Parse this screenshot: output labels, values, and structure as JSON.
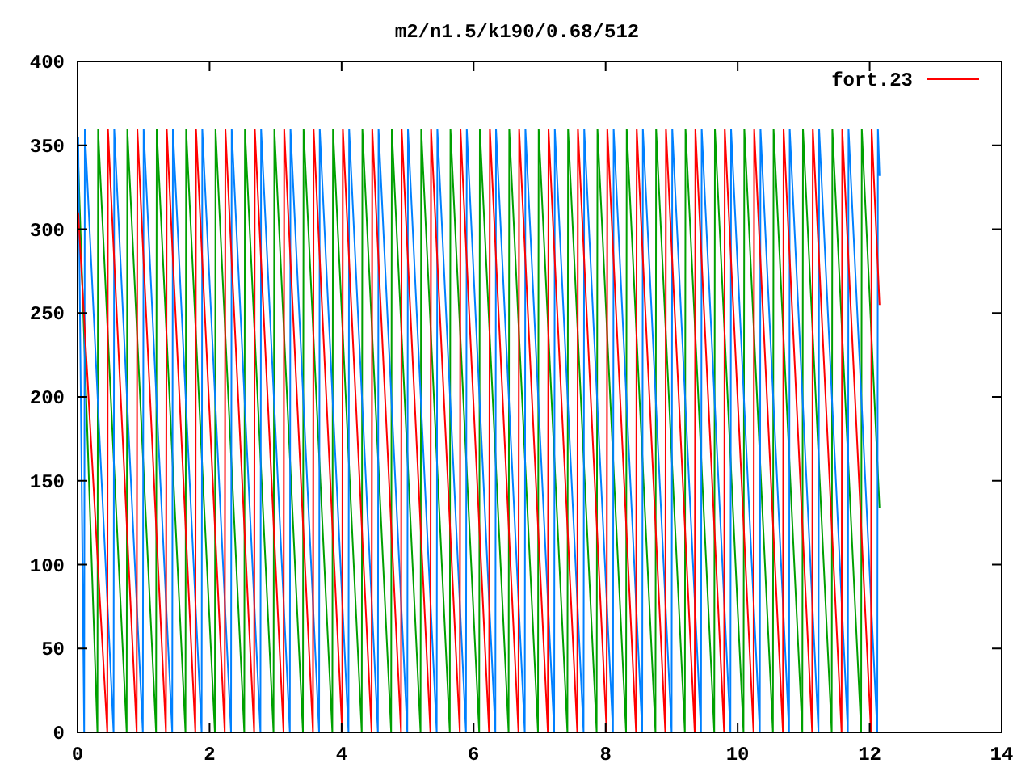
{
  "chart": {
    "title": "m2/n1.5/k190/0.68/512",
    "legend": [
      {
        "label": "fort.23",
        "color": "#ff0000"
      }
    ],
    "xticks": [
      "0",
      "2",
      "4",
      "6",
      "8",
      "10",
      "12",
      "14"
    ],
    "yticks": [
      "400",
      "350",
      "300",
      "250",
      "200",
      "150",
      "100",
      "50",
      "0"
    ]
  }
}
